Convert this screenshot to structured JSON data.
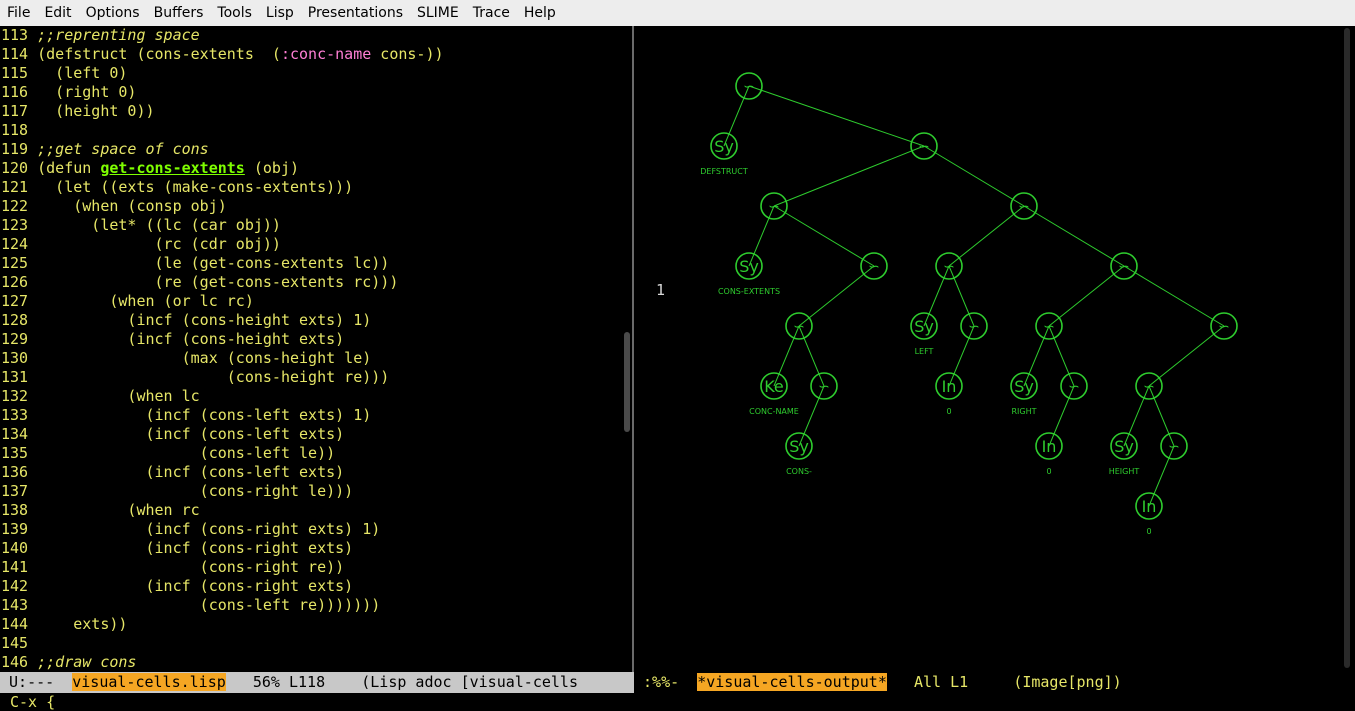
{
  "menu": [
    "File",
    "Edit",
    "Options",
    "Buffers",
    "Tools",
    "Lisp",
    "Presentations",
    "SLIME",
    "Trace",
    "Help"
  ],
  "code_lines": [
    {
      "n": "113",
      "t": [
        [
          "cm",
          ";;reprenting space"
        ]
      ]
    },
    {
      "n": "114",
      "t": [
        [
          "pl",
          "(defstruct (cons-extents  ("
        ],
        [
          "st",
          ":conc-name"
        ],
        [
          "pl",
          " cons-))"
        ]
      ]
    },
    {
      "n": "115",
      "t": [
        [
          "pl",
          "  (left 0)"
        ]
      ]
    },
    {
      "n": "116",
      "t": [
        [
          "pl",
          "  (right 0)"
        ]
      ]
    },
    {
      "n": "117",
      "t": [
        [
          "pl",
          "  (height 0))"
        ]
      ]
    },
    {
      "n": "118",
      "t": [
        [
          "pl",
          ""
        ]
      ]
    },
    {
      "n": "119",
      "t": [
        [
          "cm",
          ";;get space of cons"
        ]
      ]
    },
    {
      "n": "120",
      "t": [
        [
          "pl",
          "(defun "
        ],
        [
          "fn",
          "get-cons-extents"
        ],
        [
          "pl",
          " (obj)"
        ]
      ]
    },
    {
      "n": "121",
      "t": [
        [
          "pl",
          "  (let ((exts (make-cons-extents)))"
        ]
      ]
    },
    {
      "n": "122",
      "t": [
        [
          "pl",
          "    (when (consp obj)"
        ]
      ]
    },
    {
      "n": "123",
      "t": [
        [
          "pl",
          "      (let* ((lc (car obj))"
        ]
      ]
    },
    {
      "n": "124",
      "t": [
        [
          "pl",
          "             (rc (cdr obj))"
        ]
      ]
    },
    {
      "n": "125",
      "t": [
        [
          "pl",
          "             (le (get-cons-extents lc))"
        ]
      ]
    },
    {
      "n": "126",
      "t": [
        [
          "pl",
          "             (re (get-cons-extents rc)))"
        ]
      ]
    },
    {
      "n": "127",
      "t": [
        [
          "pl",
          "        (when (or lc rc)"
        ]
      ]
    },
    {
      "n": "128",
      "t": [
        [
          "pl",
          "          (incf (cons-height exts) 1)"
        ]
      ]
    },
    {
      "n": "129",
      "t": [
        [
          "pl",
          "          (incf (cons-height exts)"
        ]
      ]
    },
    {
      "n": "130",
      "t": [
        [
          "pl",
          "                (max (cons-height le)"
        ]
      ]
    },
    {
      "n": "131",
      "t": [
        [
          "pl",
          "                     (cons-height re)))"
        ]
      ]
    },
    {
      "n": "132",
      "t": [
        [
          "pl",
          "          (when lc"
        ]
      ]
    },
    {
      "n": "133",
      "t": [
        [
          "pl",
          "            (incf (cons-left exts) 1)"
        ]
      ]
    },
    {
      "n": "134",
      "t": [
        [
          "pl",
          "            (incf (cons-left exts)"
        ]
      ]
    },
    {
      "n": "135",
      "t": [
        [
          "pl",
          "                  (cons-left le))"
        ]
      ]
    },
    {
      "n": "136",
      "t": [
        [
          "pl",
          "            (incf (cons-left exts)"
        ]
      ]
    },
    {
      "n": "137",
      "t": [
        [
          "pl",
          "                  (cons-right le)))"
        ]
      ]
    },
    {
      "n": "138",
      "t": [
        [
          "pl",
          "          (when rc"
        ]
      ]
    },
    {
      "n": "139",
      "t": [
        [
          "pl",
          "            (incf (cons-right exts) 1)"
        ]
      ]
    },
    {
      "n": "140",
      "t": [
        [
          "pl",
          "            (incf (cons-right exts)"
        ]
      ]
    },
    {
      "n": "141",
      "t": [
        [
          "pl",
          "                  (cons-right re))"
        ]
      ]
    },
    {
      "n": "142",
      "t": [
        [
          "pl",
          "            (incf (cons-right exts)"
        ]
      ]
    },
    {
      "n": "143",
      "t": [
        [
          "pl",
          "                  (cons-left re)))))))"
        ]
      ]
    },
    {
      "n": "144",
      "t": [
        [
          "pl",
          "    exts))"
        ]
      ]
    },
    {
      "n": "145",
      "t": [
        [
          "pl",
          ""
        ]
      ]
    },
    {
      "n": "146",
      "t": [
        [
          "cm",
          ";;draw cons"
        ]
      ]
    }
  ],
  "output": {
    "line_number": "1",
    "tree_color": "#2ecc2e",
    "cons_symbol": "∽",
    "leaves": [
      {
        "glyph": "Sy",
        "label": "DEFSTRUCT"
      },
      {
        "glyph": "Sy",
        "label": "CONS-EXTENTS"
      },
      {
        "glyph": "Sy",
        "label": "LEFT"
      },
      {
        "glyph": "Ke",
        "label": "CONC-NAME"
      },
      {
        "glyph": "In",
        "label": "0"
      },
      {
        "glyph": "Sy",
        "label": "RIGHT"
      },
      {
        "glyph": "Sy",
        "label": "CONS-"
      },
      {
        "glyph": "In",
        "label": "0"
      },
      {
        "glyph": "Sy",
        "label": "HEIGHT"
      },
      {
        "glyph": "In",
        "label": "0"
      }
    ]
  },
  "modeline_left": {
    "status": " U:---  ",
    "buffer": "visual-cells.lisp",
    "position": "   56% L118    ",
    "mode": "(Lisp adoc [visual-cells"
  },
  "modeline_right": {
    "status": " :%%-  ",
    "buffer": "*visual-cells-output*",
    "position": "   All L1     ",
    "mode": "(Image[png])"
  },
  "minibuffer": "C-x {"
}
